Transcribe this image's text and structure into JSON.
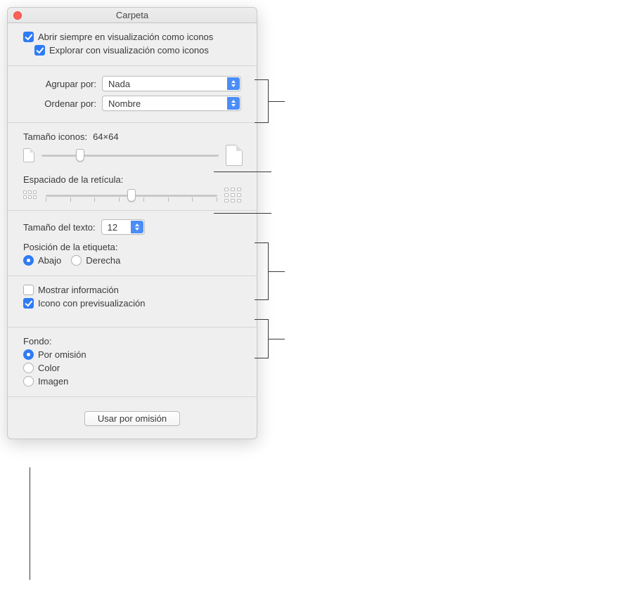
{
  "titlebar": {
    "title": "Carpeta"
  },
  "open_section": {
    "always_open_label": "Abrir siempre en visualización como iconos",
    "always_open_checked": true,
    "browse_label": "Explorar con visualización como iconos",
    "browse_checked": true
  },
  "arrange": {
    "group_by_label": "Agrupar por:",
    "group_by_value": "Nada",
    "sort_by_label": "Ordenar por:",
    "sort_by_value": "Nombre"
  },
  "icons": {
    "size_label": "Tamaño iconos:",
    "size_value": "64×64",
    "size_percent": 22,
    "grid_label": "Espaciado de la retícula:",
    "grid_percent": 50
  },
  "text": {
    "size_label": "Tamaño del texto:",
    "size_value": "12",
    "label_pos_label": "Posición de la etiqueta:",
    "bottom_label": "Abajo",
    "right_label": "Derecha",
    "position": "bottom"
  },
  "info": {
    "show_info_label": "Mostrar información",
    "show_info_checked": false,
    "preview_label": "Icono con previsualización",
    "preview_checked": true
  },
  "background": {
    "heading": "Fondo:",
    "default_label": "Por omisión",
    "color_label": "Color",
    "image_label": "Imagen",
    "selected": "default"
  },
  "footer": {
    "use_defaults_label": "Usar por omisión"
  }
}
